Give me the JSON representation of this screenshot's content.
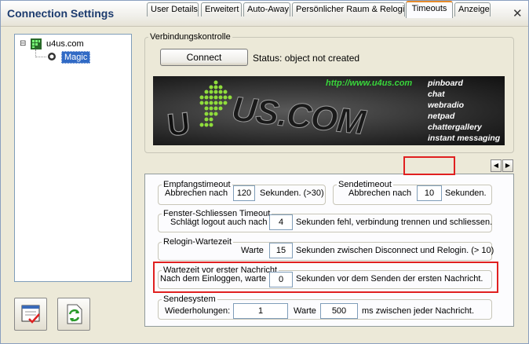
{
  "window": {
    "title": "Connection Settings",
    "close_label": "✕"
  },
  "tree": {
    "root": "u4us.com",
    "collapse_glyph": "⊟",
    "child": "Magic"
  },
  "connection": {
    "legend": "Verbindungskontrolle",
    "connect_label": "Connect",
    "status": "Status: object not created"
  },
  "banner": {
    "url": "http://www.u4us.com",
    "logo_text": "US.COM",
    "items": [
      "pinboard",
      "chat",
      "webradio",
      "netpad",
      "chattergallery",
      "instant messaging"
    ]
  },
  "tabs": [
    {
      "label": "User Details"
    },
    {
      "label": "Erweitert"
    },
    {
      "label": "Auto-Away"
    },
    {
      "label": "Persönlicher Raum & Relogin"
    },
    {
      "label": "Timeouts"
    },
    {
      "label": "Anzeigec"
    }
  ],
  "scroll": {
    "left": "◀",
    "right": "▶"
  },
  "timeouts": {
    "empfang": {
      "legend": "Empfangstimeout",
      "prefix": "Abbrechen nach",
      "value": "120",
      "suffix": "Sekunden. (>30)"
    },
    "sende": {
      "legend": "Sendetimeout",
      "prefix": "Abbrechen nach",
      "value": "10",
      "suffix": "Sekunden."
    },
    "fenster": {
      "legend": "Fenster-Schliessen Timeout",
      "prefix": "Schlägt logout auch nach",
      "value": "4",
      "suffix": "Sekunden fehl, verbindung trennen und schliessen."
    },
    "relogin": {
      "legend": "Relogin-Wartezeit",
      "prefix": "Warte",
      "value": "15",
      "suffix": "Sekunden zwischen Disconnect und Relogin. (> 10)"
    },
    "warte": {
      "legend": "Wartezeit vor erster Nachricht",
      "prefix": "Nach dem Einloggen, warte",
      "value": "0",
      "suffix": "Sekunden vor dem Senden der ersten Nachricht."
    },
    "sendesystem": {
      "legend": "Sendesystem",
      "wiederholungen_label": "Wiederholungen:",
      "wiederholungen_value": "1",
      "warte_label": "Warte",
      "warte_value": "500",
      "suffix": "ms zwischen jeder Nachricht."
    }
  },
  "colors": {
    "highlight": "#e02020",
    "active_tab_accent": "#e68b2c",
    "banner_url": "#39d63b"
  }
}
